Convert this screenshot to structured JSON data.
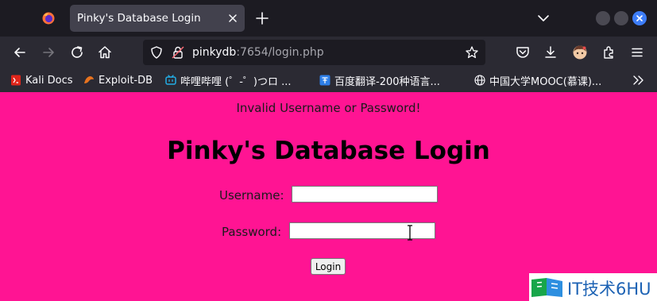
{
  "browser": {
    "tab": {
      "title": "Pinky's Database Login"
    },
    "url": {
      "host": "pinkydb",
      "rest": ":7654/login.php"
    },
    "bookmarks": [
      {
        "label": "Kali Docs"
      },
      {
        "label": "Exploit-DB"
      },
      {
        "label": "哔哩哔哩 (゜-゜)つロ ..."
      },
      {
        "label": "百度翻译-200种语言..."
      },
      {
        "label": "中国大学MOOC(慕课)..."
      }
    ]
  },
  "page": {
    "error": "Invalid Username or Password!",
    "heading": "Pinky's Database Login",
    "username_label": "Username:",
    "username_value": "",
    "password_label": "Password:",
    "password_value": "",
    "login_label": "Login",
    "background_color": "#ff1493"
  },
  "watermark": {
    "text": "IT技术6HU"
  }
}
